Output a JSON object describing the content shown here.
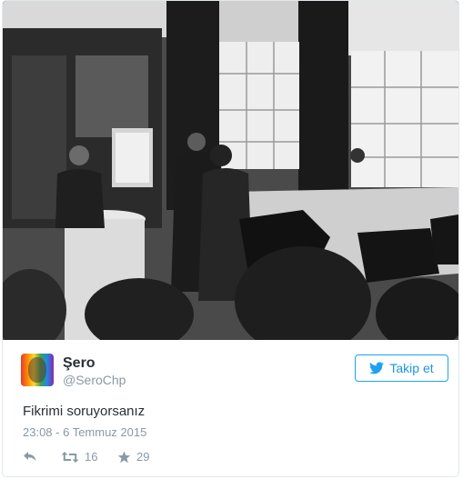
{
  "tweet": {
    "display_name": "Şero",
    "screen_name": "@SeroChp",
    "follow_label": "Takip et",
    "text": "Fikrimi soruyorsanız",
    "timestamp": "23:08 - 6 Temmuz 2015",
    "retweet_count": "16",
    "like_count": "29"
  },
  "icons": {
    "follow": "twitter-bird-icon",
    "reply": "reply-icon",
    "retweet": "retweet-icon",
    "like": "star-icon"
  },
  "colors": {
    "accent": "#1da1f2",
    "text": "#292f33",
    "muted": "#8899a6",
    "border": "#e1e8ed"
  }
}
